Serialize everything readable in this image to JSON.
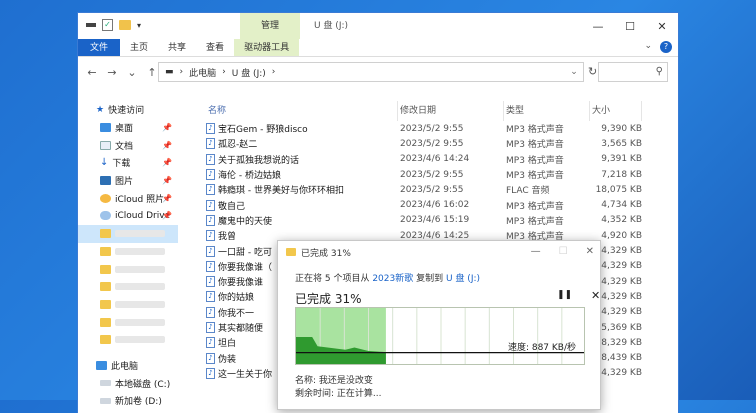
{
  "window": {
    "title": "U 盘 (J:)",
    "manage_tab": "管理",
    "ribbon_tabs": [
      "文件",
      "主页",
      "共享",
      "查看",
      "驱动器工具"
    ]
  },
  "address": {
    "path": [
      "此电脑",
      "U 盘 (J:)"
    ]
  },
  "sidebar": {
    "quick_access": "快速访问",
    "items": [
      {
        "label": "桌面",
        "pinned": true
      },
      {
        "label": "文档",
        "pinned": true
      },
      {
        "label": "下载",
        "pinned": true
      },
      {
        "label": "图片",
        "pinned": true
      },
      {
        "label": "iCloud 照片",
        "pinned": true
      },
      {
        "label": "iCloud Drive",
        "pinned": true
      }
    ],
    "this_pc": "此电脑",
    "drives": [
      "本地磁盘 (C:)",
      "新加卷 (D:)"
    ]
  },
  "columns": [
    "名称",
    "修改日期",
    "类型",
    "大小"
  ],
  "files": [
    {
      "name": "宝石Gem - 野狼disco",
      "date": "2023/5/2 9:55",
      "type": "MP3 格式声音",
      "size": "9,390 KB"
    },
    {
      "name": "孤忍-赵二",
      "date": "2023/5/2 9:55",
      "type": "MP3 格式声音",
      "size": "3,565 KB"
    },
    {
      "name": "关于孤独我想说的话",
      "date": "2023/4/6 14:24",
      "type": "MP3 格式声音",
      "size": "9,391 KB"
    },
    {
      "name": "海伦 - 桥边姑娘",
      "date": "2023/5/2 9:55",
      "type": "MP3 格式声音",
      "size": "7,218 KB"
    },
    {
      "name": "韩瘾琪 - 世界美好与你环环相扣",
      "date": "2023/5/2 9:55",
      "type": "FLAC 音频",
      "size": "18,075 KB"
    },
    {
      "name": "敬自己",
      "date": "2023/4/6 16:02",
      "type": "MP3 格式声音",
      "size": "4,734 KB"
    },
    {
      "name": "魔鬼中的天使",
      "date": "2023/4/6 15:19",
      "type": "MP3 格式声音",
      "size": "4,352 KB"
    },
    {
      "name": "我曾",
      "date": "2023/4/6 14:25",
      "type": "MP3 格式声音",
      "size": "4,920 KB"
    },
    {
      "name": "一口甜 - 吃可",
      "date": "",
      "type": "",
      "size": "4,329 KB"
    },
    {
      "name": "你要我像谁（",
      "date": "",
      "type": "",
      "size": "4,329 KB"
    },
    {
      "name": "你要我像谁",
      "date": "",
      "type": "",
      "size": "4,329 KB"
    },
    {
      "name": "你的姑娘",
      "date": "",
      "type": "",
      "size": "4,329 KB"
    },
    {
      "name": "你我不一",
      "date": "",
      "type": "",
      "size": "4,329 KB"
    },
    {
      "name": "其实都随便",
      "date": "",
      "type": "",
      "size": "5,369 KB"
    },
    {
      "name": "坦白",
      "date": "",
      "type": "",
      "size": "8,329 KB"
    },
    {
      "name": "伪装",
      "date": "",
      "type": "",
      "size": "8,439 KB"
    },
    {
      "name": "这一生关于你",
      "date": "",
      "type": "",
      "size": "4,329 KB"
    }
  ],
  "dialog": {
    "title": "已完成 31%",
    "line_prefix": "正在将 5 个项目从",
    "source": "2023新歌",
    "line_mid": "复制到",
    "dest": "U 盘 (J:)",
    "percent_text": "已完成 31%",
    "progress": 0.31,
    "speed": "速度: 887 KB/秒",
    "name_line": "名称: 我还是没改变",
    "remaining_line": "剩余时间: 正在计算..."
  }
}
